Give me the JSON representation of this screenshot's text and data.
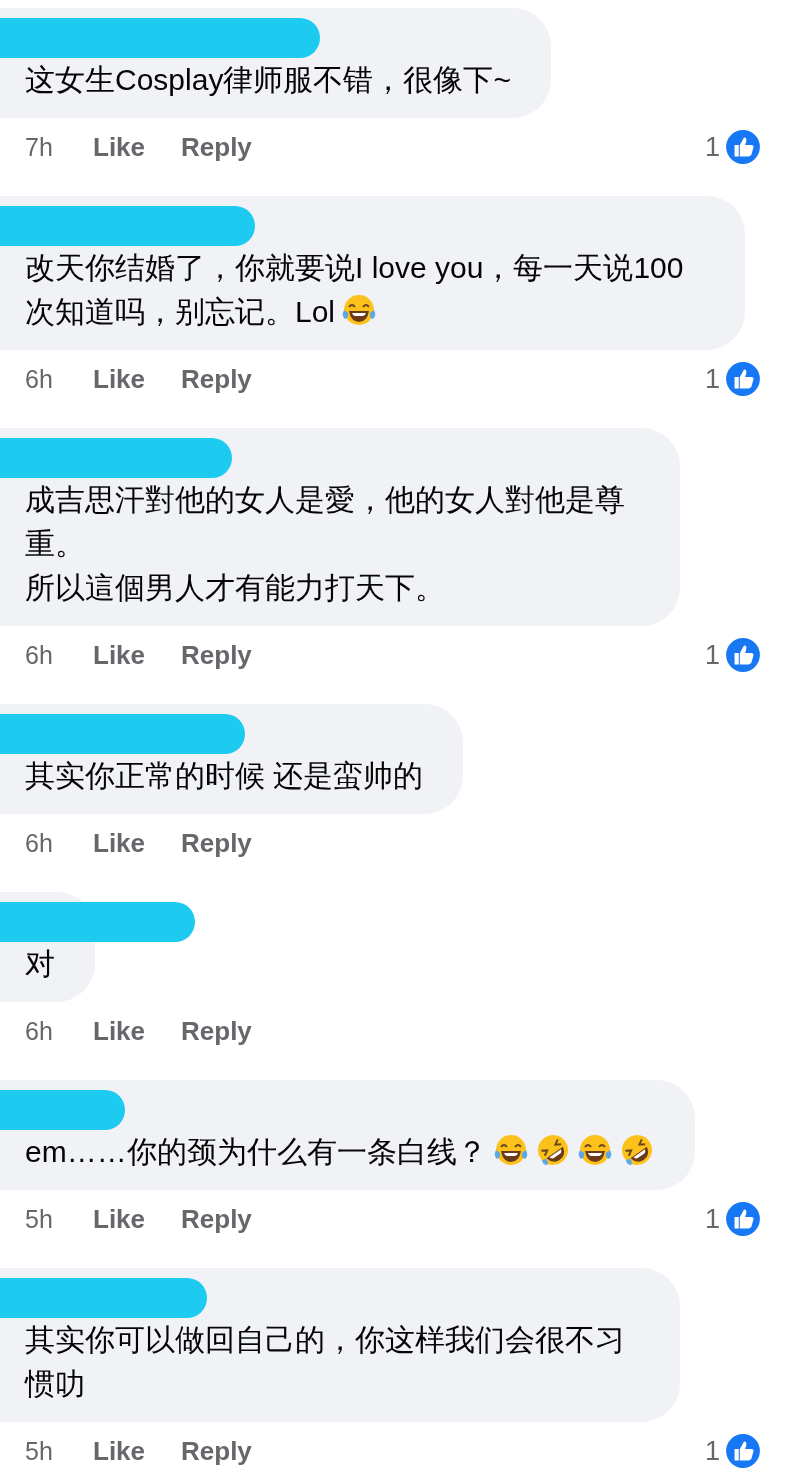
{
  "comments": [
    {
      "lines": [
        "这女生Cosplay律师服不错，很像下~"
      ],
      "time": "7h",
      "like": "Like",
      "reply": "Reply",
      "reactions": "1"
    },
    {
      "lines": [
        "改天你结婚了，你就要说I love you，每一天说100次知道吗，别忘记。Lol"
      ],
      "emojis": [
        {
          "kind": "joy"
        }
      ],
      "time": "6h",
      "like": "Like",
      "reply": "Reply",
      "reactions": "1"
    },
    {
      "lines": [
        "成吉思汗對他的女人是愛，他的女人對他是尊重。",
        "所以這個男人才有能力打天下。"
      ],
      "time": "6h",
      "like": "Like",
      "reply": "Reply",
      "reactions": "1"
    },
    {
      "lines": [
        "其实你正常的时候 还是蛮帅的"
      ],
      "time": "6h",
      "like": "Like",
      "reply": "Reply"
    },
    {
      "lines": [
        "对"
      ],
      "time": "6h",
      "like": "Like",
      "reply": "Reply"
    },
    {
      "lines": [
        "em……你的颈为什么有一条白线？"
      ],
      "emojis": [
        {
          "kind": "joy"
        },
        {
          "kind": "rofl"
        },
        {
          "kind": "joy"
        },
        {
          "kind": "rofl"
        }
      ],
      "time": "5h",
      "like": "Like",
      "reply": "Reply",
      "reactions": "1"
    },
    {
      "lines": [
        "其实你可以做回自己的，你这样我们会很不习惯叻"
      ],
      "time": "5h",
      "like": "Like",
      "reply": "Reply",
      "reactions": "1"
    }
  ]
}
